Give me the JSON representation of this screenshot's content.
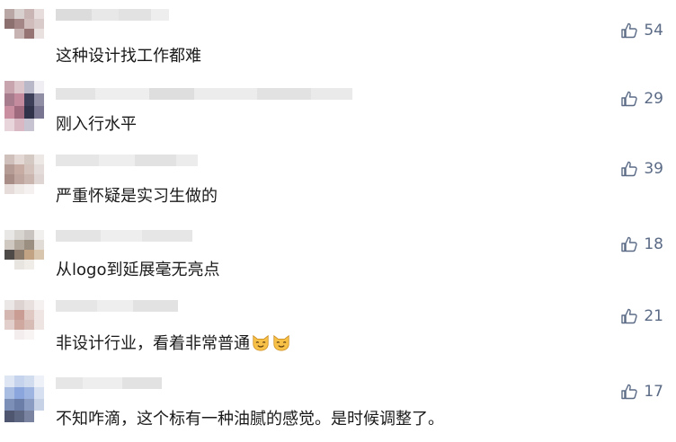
{
  "comments": [
    {
      "text": "这种设计找工作都难",
      "likes": "54"
    },
    {
      "text": "刚入行水平",
      "likes": "29"
    },
    {
      "text": "严重怀疑是实习生做的",
      "likes": "39"
    },
    {
      "text": "从logo到延展毫无亮点",
      "likes": "18"
    },
    {
      "text": "非设计行业，看着非常普通",
      "likes": "21",
      "emoji": [
        "cat-face-icon",
        "cat-face-icon"
      ]
    },
    {
      "text": "不知咋滴，这个标有一种油腻的感觉。是时候调整了。",
      "likes": "17"
    }
  ],
  "colors": {
    "like_icon": "#5b6b86",
    "text": "#1a1a1a"
  }
}
